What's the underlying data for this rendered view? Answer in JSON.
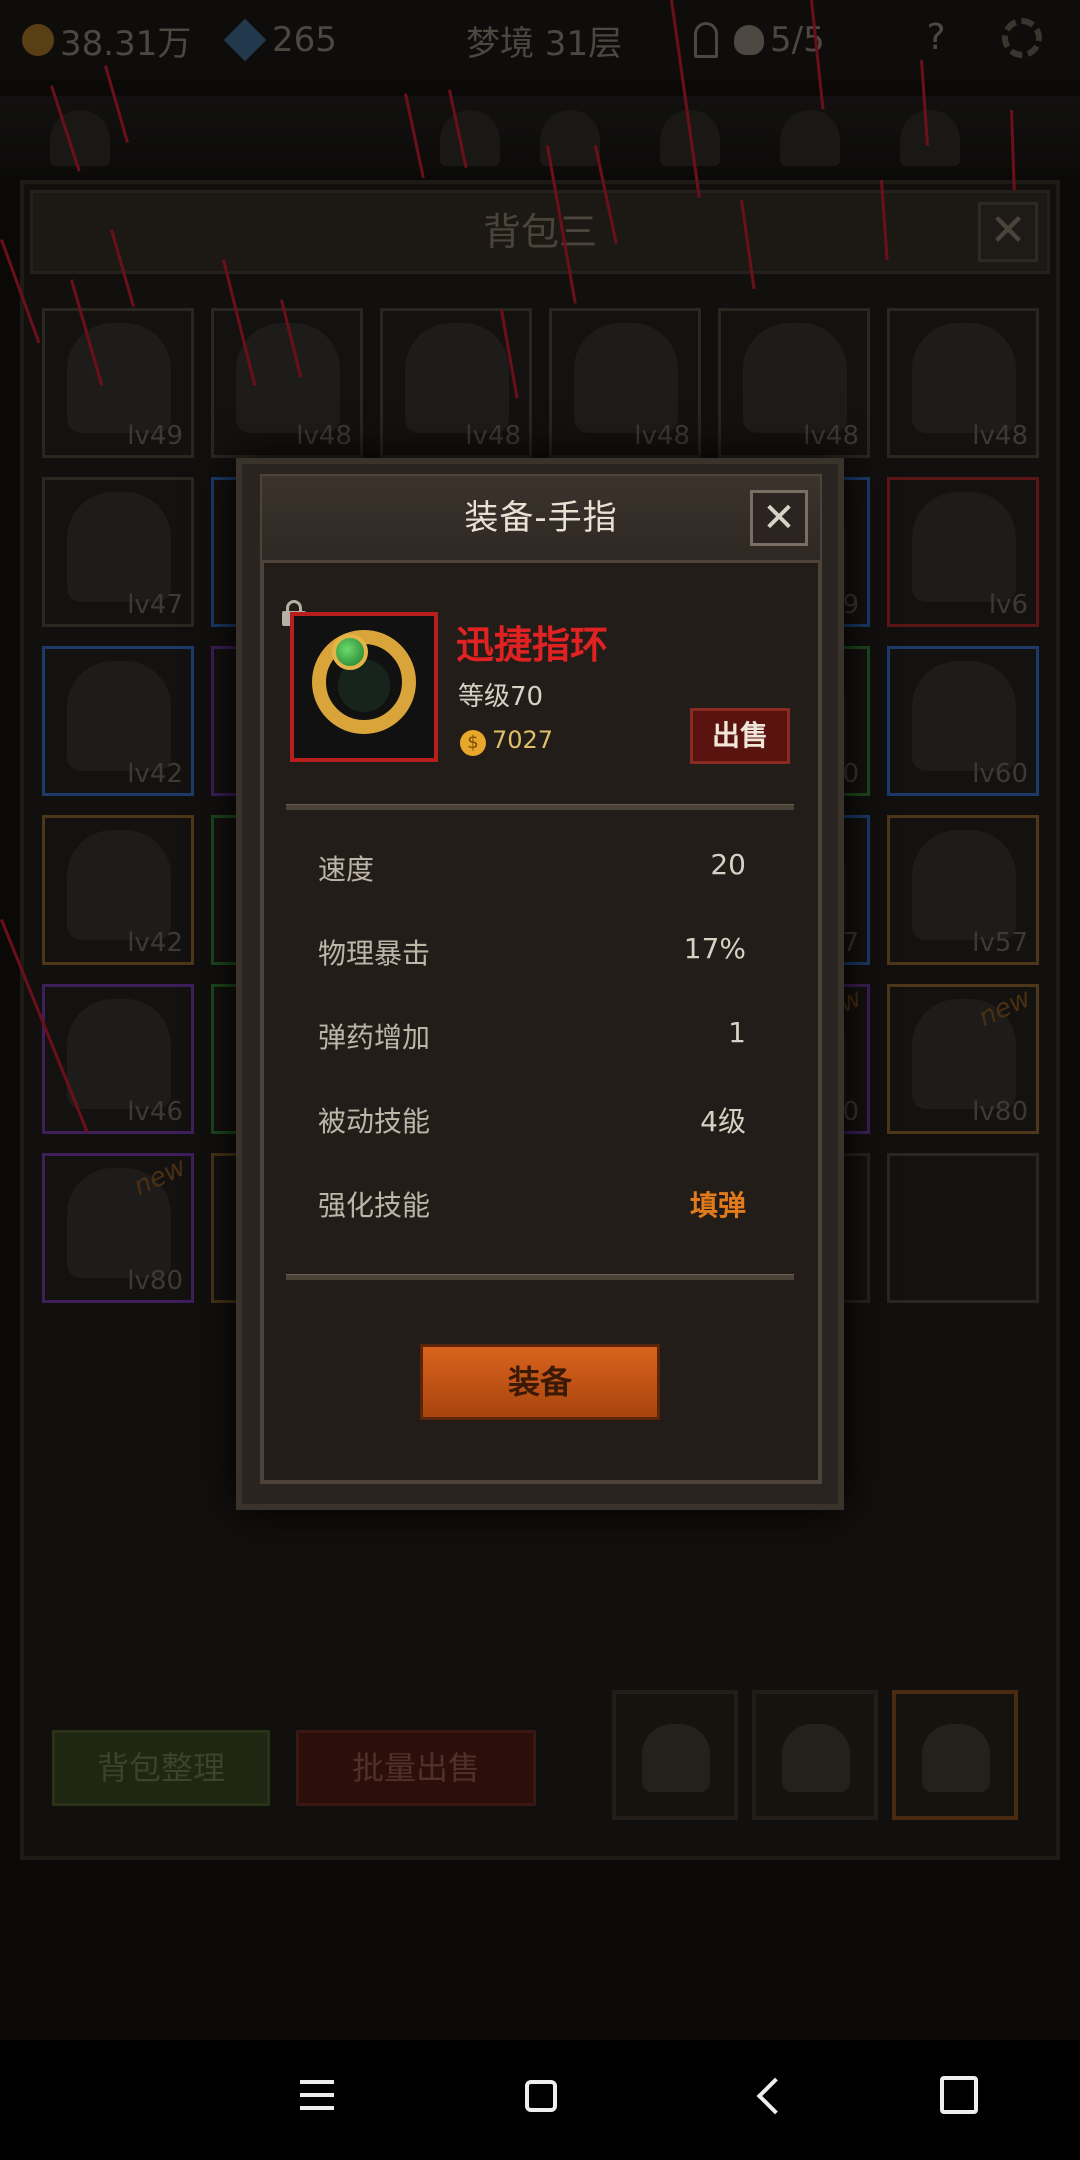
{
  "status_bar": {
    "gold": "38.31万",
    "gems": "265",
    "stage": "梦境 31层",
    "keys": "",
    "skulls": "5/5",
    "help": "?"
  },
  "bag": {
    "title": "背包三",
    "close": "✕",
    "sort_label": "背包整理",
    "bulk_sell_label": "批量出售",
    "slots": [
      {
        "lv": "lv49",
        "rarity": "gray",
        "new": ""
      },
      {
        "lv": "lv48",
        "rarity": "gray",
        "new": ""
      },
      {
        "lv": "lv48",
        "rarity": "gray",
        "new": ""
      },
      {
        "lv": "lv48",
        "rarity": "gray",
        "new": ""
      },
      {
        "lv": "lv48",
        "rarity": "gray",
        "new": ""
      },
      {
        "lv": "lv48",
        "rarity": "gray",
        "new": ""
      },
      {
        "lv": "lv47",
        "rarity": "gray",
        "new": ""
      },
      {
        "lv": "",
        "rarity": "blue",
        "new": ""
      },
      {
        "lv": "",
        "rarity": "gray",
        "new": ""
      },
      {
        "lv": "",
        "rarity": "gray",
        "new": ""
      },
      {
        "lv": "9",
        "rarity": "blue",
        "new": ""
      },
      {
        "lv": "lv6",
        "rarity": "red",
        "new": ""
      },
      {
        "lv": "lv42",
        "rarity": "blue",
        "new": ""
      },
      {
        "lv": "",
        "rarity": "purple",
        "new": ""
      },
      {
        "lv": "",
        "rarity": "gray",
        "new": ""
      },
      {
        "lv": "",
        "rarity": "gray",
        "new": ""
      },
      {
        "lv": "0",
        "rarity": "green",
        "new": ""
      },
      {
        "lv": "lv60",
        "rarity": "blue",
        "new": ""
      },
      {
        "lv": "lv42",
        "rarity": "orange",
        "new": ""
      },
      {
        "lv": "",
        "rarity": "green",
        "new": ""
      },
      {
        "lv": "",
        "rarity": "gray",
        "new": ""
      },
      {
        "lv": "",
        "rarity": "gray",
        "new": ""
      },
      {
        "lv": "7",
        "rarity": "blue",
        "new": ""
      },
      {
        "lv": "lv57",
        "rarity": "orange",
        "new": ""
      },
      {
        "lv": "lv46",
        "rarity": "purple",
        "new": ""
      },
      {
        "lv": "",
        "rarity": "green",
        "new": ""
      },
      {
        "lv": "",
        "rarity": "gray",
        "new": ""
      },
      {
        "lv": "",
        "rarity": "gray",
        "new": ""
      },
      {
        "lv": "0",
        "rarity": "purple",
        "new": "new"
      },
      {
        "lv": "lv80",
        "rarity": "orange",
        "new": "new"
      },
      {
        "lv": "lv80",
        "rarity": "purple",
        "new": "new"
      },
      {
        "lv": "",
        "rarity": "orange",
        "new": ""
      },
      {
        "lv": "",
        "rarity": "gray",
        "new": ""
      },
      {
        "lv": "",
        "rarity": "gray",
        "new": ""
      },
      {
        "lv": "",
        "rarity": "gray",
        "new": ""
      },
      {
        "lv": "",
        "rarity": "gray",
        "new": ""
      }
    ]
  },
  "modal": {
    "title": "装备-手指",
    "close": "✕",
    "item_name": "迅捷指环",
    "item_level": "等级70",
    "price": "7027",
    "price_coin": "$",
    "sell_label": "出售",
    "stats": [
      {
        "name": "速度",
        "value": "20",
        "highlight": false
      },
      {
        "name": "物理暴击",
        "value": "17%",
        "highlight": false
      },
      {
        "name": "弹药增加",
        "value": "1",
        "highlight": false
      },
      {
        "name": "被动技能",
        "value": "4级",
        "highlight": false
      },
      {
        "name": "强化技能",
        "value": "填弹",
        "highlight": true
      }
    ],
    "equip_label": "装备",
    "name_color": "#e02222",
    "accent_color": "#e07a1a"
  },
  "icons": {
    "coin": "gold-coin-icon",
    "gem": "gem-icon",
    "lock": "lock-icon",
    "close": "close-icon",
    "ring": "ring-icon"
  }
}
